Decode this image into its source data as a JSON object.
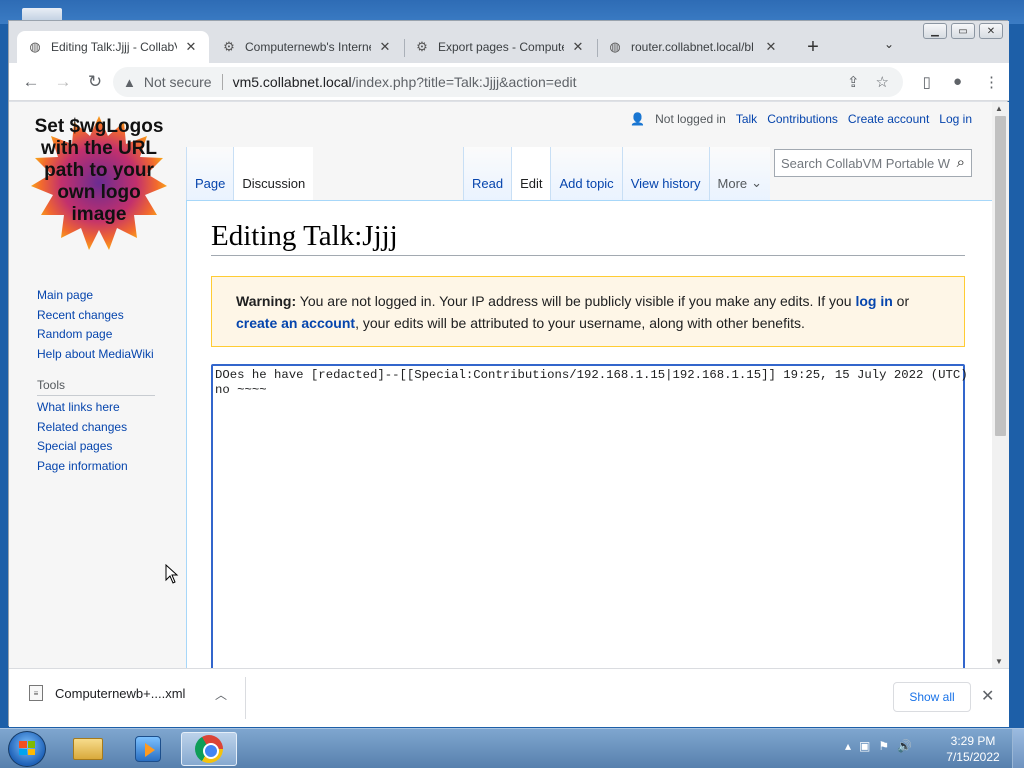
{
  "browser": {
    "tabs": [
      {
        "title": "Editing Talk:Jjjj - CollabV",
        "active": true,
        "icon": "collabvm-favicon"
      },
      {
        "title": "Computernewb's Interne",
        "active": false,
        "icon": "wiki-favicon"
      },
      {
        "title": "Export pages - Compute",
        "active": false,
        "icon": "wiki-favicon"
      },
      {
        "title": "router.collabnet.local/bl",
        "active": false,
        "icon": "globe-icon"
      }
    ],
    "new_tab_label": "+",
    "omnibox": {
      "security_label": "Not secure",
      "url_host": "vm5.collabnet.local",
      "url_path": "/index.php?title=Talk:Jjjj&action=edit"
    }
  },
  "wiki": {
    "logo_text": "Set $wgLogos with the URL path to your own logo image",
    "personal": {
      "not_logged_in": "Not logged in",
      "talk": "Talk",
      "contributions": "Contributions",
      "create_account": "Create account",
      "log_in": "Log in"
    },
    "nav": [
      "Main page",
      "Recent changes",
      "Random page",
      "Help about MediaWiki"
    ],
    "tools_header": "Tools",
    "tools": [
      "What links here",
      "Related changes",
      "Special pages",
      "Page information"
    ],
    "tabs_left": [
      {
        "label": "Page",
        "selected": false
      },
      {
        "label": "Discussion",
        "selected": true
      }
    ],
    "tabs_right": [
      {
        "label": "Read",
        "selected": false
      },
      {
        "label": "Edit",
        "selected": true
      },
      {
        "label": "Add topic",
        "selected": false
      },
      {
        "label": "View history",
        "selected": false
      }
    ],
    "more_label": "More",
    "search_placeholder": "Search CollabVM Portable W",
    "heading": "Editing Talk:Jjjj",
    "warning": {
      "bold": "Warning:",
      "text1": " You are not logged in. Your IP address will be publicly visible if you make any edits. If you ",
      "link1": "log in",
      "text2": " or",
      "link2": "create an account",
      "text3": ", your edits will be attributed to your username, along with other benefits."
    },
    "editor_text": "DOes he have [redacted]--[[Special:Contributions/192.168.1.15|192.168.1.15]] 19:25, 15 July 2022 (UTC)\nno ~~~~"
  },
  "downloads": {
    "file_name": "Computernewb+....xml",
    "show_all": "Show all"
  },
  "taskbar": {
    "time": "3:29 PM",
    "date": "7/15/2022"
  }
}
